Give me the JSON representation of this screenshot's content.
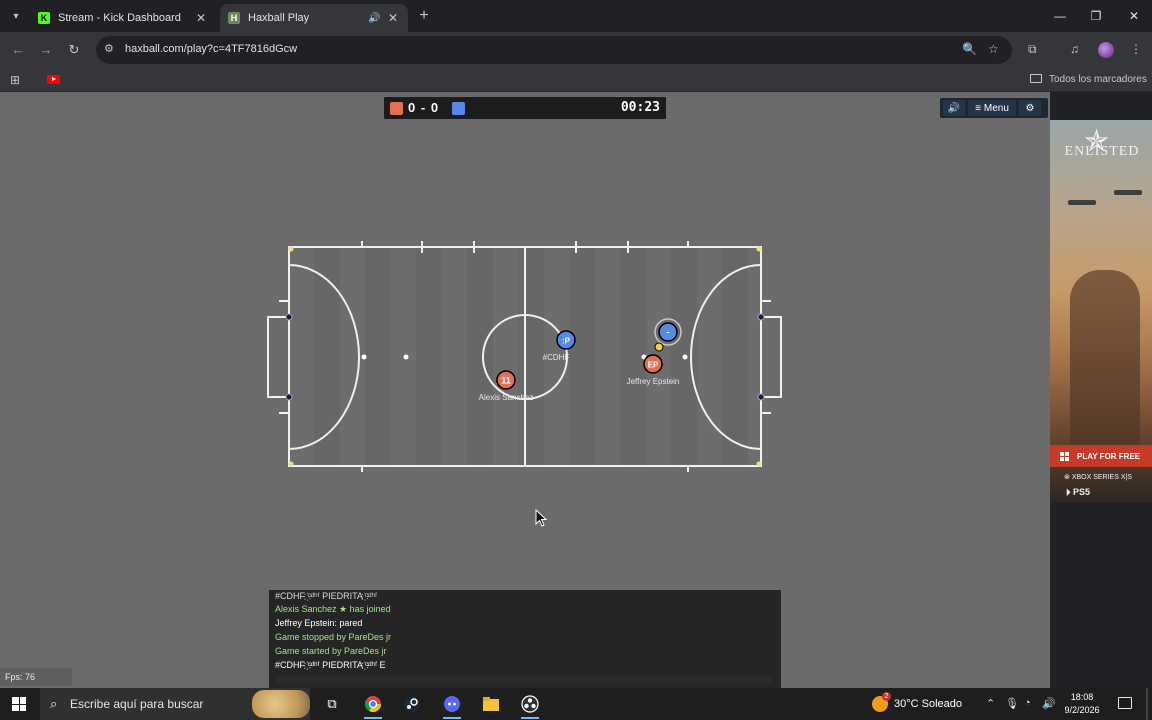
{
  "browser": {
    "tabs": [
      {
        "title": "Stream - Kick Dashboard",
        "favicon": "kick-icon",
        "active": false
      },
      {
        "title": "Haxball Play",
        "favicon": "haxball-icon",
        "active": true
      }
    ],
    "url": "haxball.com/play?c=4TF7816dGcw",
    "bookmarks_folder": "Todos los marcadores"
  },
  "game": {
    "score_red": "0",
    "score_sep": "-",
    "score_blue": "0",
    "timer": "00:23",
    "menu_label": "Menu",
    "fps_label": "Fps: 76",
    "team_colors": {
      "red": "#e56e56",
      "blue": "#5689e5"
    },
    "players": [
      {
        "avatar": "11",
        "name": "Alexis Sanchez",
        "team": "red"
      },
      {
        "avatar": "EP",
        "name": "Jeffrey Epstein",
        "team": "red"
      },
      {
        "avatar": ":P",
        "name": "#CDHF",
        "team": "blue"
      },
      {
        "avatar": "-",
        "name": "",
        "team": "blue"
      }
    ]
  },
  "chat": {
    "lines": [
      {
        "text": "#CDHF ҉ᶜᵈʰᶠ PIEDRITA ҉ᶜᵈʰᶠ",
        "color": "#dcdcdc"
      },
      {
        "text": "Alexis Sanchez ★ has joined",
        "color": "#a6e08a"
      },
      {
        "text": "Jeffrey Epstein: pared",
        "color": "#ffffff"
      },
      {
        "text": "Game stopped by ParеDes jr",
        "color": "#a6e08a"
      },
      {
        "text": "Game started by ParеDes jr",
        "color": "#a6e08a"
      },
      {
        "text": "#CDHF ҉ᶜᵈʰᶠ PIEDRITA ҉ᶜᵈʰᶠ E",
        "color": "#ffffff"
      }
    ]
  },
  "ad": {
    "brand": "ENLISTED",
    "cta": "PLAY FOR FREE",
    "platform1": "XBOX SERIES X|S",
    "platform2": "PS5"
  },
  "taskbar": {
    "search_placeholder": "Escribe aquí para buscar",
    "weather": "30°C  Soleado",
    "weather_badge": "2",
    "time": "18:08",
    "date": "9/2/2026"
  }
}
